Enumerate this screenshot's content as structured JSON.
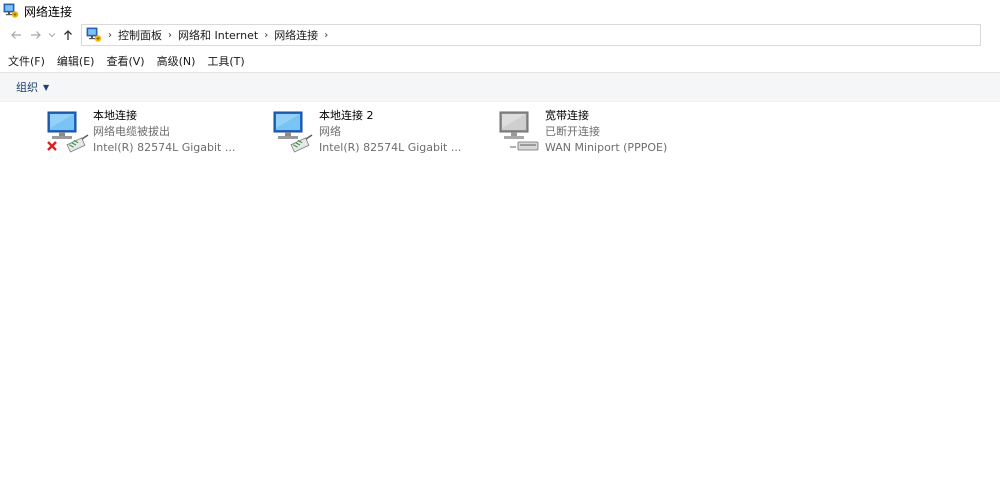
{
  "window": {
    "title": "网络连接"
  },
  "nav": {
    "back_icon": "arrow-left-icon",
    "forward_icon": "arrow-right-icon",
    "recent_icon": "chevron-down-icon",
    "up_icon": "arrow-up-icon"
  },
  "breadcrumb": [
    "控制面板",
    "网络和 Internet",
    "网络连接"
  ],
  "menu": [
    "文件(F)",
    "编辑(E)",
    "查看(V)",
    "高级(N)",
    "工具(T)"
  ],
  "toolbar": {
    "organize": "组织"
  },
  "connections": [
    {
      "name": "本地连接",
      "status": "网络电缆被拔出",
      "device": "Intel(R) 82574L Gigabit ...",
      "icon": "ethernet-disconnected-icon"
    },
    {
      "name": "本地连接 2",
      "status": "网络",
      "device": "Intel(R) 82574L Gigabit ...",
      "icon": "ethernet-icon"
    },
    {
      "name": "宽带连接",
      "status": "已断开连接",
      "device": "WAN Miniport (PPPOE)",
      "icon": "broadband-disconnected-icon"
    }
  ],
  "colors": {
    "toolbar_bg": "#f5f6f7",
    "link_blue": "#1e3f6f",
    "status_gray": "#6d6d6d",
    "error_red": "#e0201a"
  }
}
